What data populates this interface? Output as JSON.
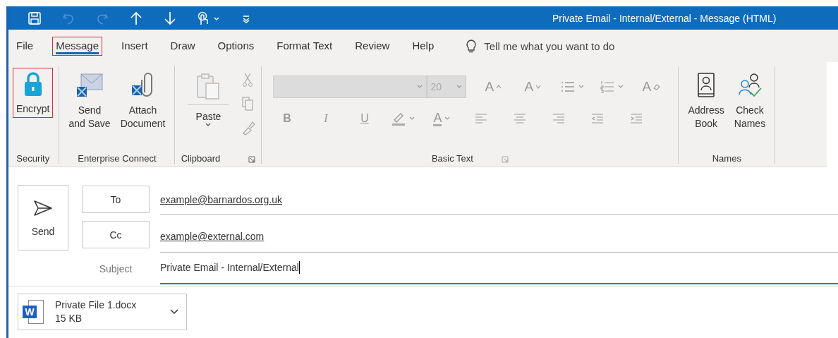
{
  "quick_access": [
    {
      "kind": "save",
      "disabled": false
    },
    {
      "kind": "undo",
      "disabled": true
    },
    {
      "kind": "redo",
      "disabled": true
    },
    {
      "kind": "up",
      "disabled": false
    },
    {
      "kind": "down",
      "disabled": false
    },
    {
      "kind": "touch",
      "disabled": false,
      "dropdown": true
    },
    {
      "kind": "customize",
      "disabled": false
    }
  ],
  "window": {
    "title": "Private Email - Internal/External  -  Message (HTML)"
  },
  "tabs": [
    {
      "label": "File",
      "selected": false,
      "highlighted": false
    },
    {
      "label": "Message",
      "selected": true,
      "highlighted": true
    },
    {
      "label": "Insert",
      "selected": false,
      "highlighted": false
    },
    {
      "label": "Draw",
      "selected": false,
      "highlighted": false
    },
    {
      "label": "Options",
      "selected": false,
      "highlighted": false
    },
    {
      "label": "Format Text",
      "selected": false,
      "highlighted": false
    },
    {
      "label": "Review",
      "selected": false,
      "highlighted": false
    },
    {
      "label": "Help",
      "selected": false,
      "highlighted": false
    }
  ],
  "tell_me": {
    "placeholder": "Tell me what you want to do"
  },
  "ribbon": {
    "security": {
      "label": "Security",
      "buttons": [
        {
          "lines": [
            "Encrypt"
          ],
          "highlighted": true
        }
      ]
    },
    "enterprise_connect": {
      "label": "Enterprise Connect",
      "buttons": [
        {
          "lines": [
            "Send",
            "and Save"
          ],
          "highlighted": false
        },
        {
          "lines": [
            "Attach",
            "Document"
          ],
          "highlighted": false
        }
      ]
    },
    "clipboard": {
      "label": "Clipboard",
      "launcher": true,
      "paste": {
        "label": "Paste"
      }
    },
    "basic_text": {
      "label": "Basic Text",
      "launcher": true,
      "font_size": {
        "value": "20"
      },
      "row_1": [
        {
          "kind": "grow",
          "label": "A"
        },
        {
          "kind": "shrink",
          "label": "A"
        },
        {
          "kind": "bullets",
          "dropdown": true
        },
        {
          "kind": "numbering",
          "dropdown": true
        },
        {
          "kind": "clear",
          "label": "A"
        }
      ],
      "row_2": [
        {
          "kind": "bold",
          "label": "B"
        },
        {
          "kind": "italic",
          "label": "I"
        },
        {
          "kind": "underline",
          "label": "U"
        },
        {
          "kind": "highlight",
          "dropdown": true
        },
        {
          "kind": "font-color",
          "label": "A",
          "dropdown": true
        },
        {
          "kind": "align-left"
        },
        {
          "kind": "align-center"
        },
        {
          "kind": "align-right"
        },
        {
          "kind": "outdent"
        },
        {
          "kind": "indent"
        }
      ]
    },
    "names": {
      "label": "Names",
      "buttons": [
        {
          "lines": [
            "Address",
            "Book"
          ],
          "highlighted": false
        },
        {
          "lines": [
            "Check",
            "Names"
          ],
          "highlighted": false
        }
      ]
    }
  },
  "compose": {
    "send": {
      "label": "Send"
    },
    "recipients": [
      {
        "button": "To",
        "value": "example@barnardos.org.uk"
      },
      {
        "button": "Cc",
        "value": "example@external.com"
      }
    ],
    "subject": {
      "label": "Subject",
      "value": "Private Email - Internal/External"
    },
    "attachments": [
      {
        "name": "Private File 1.docx",
        "size": "15 KB",
        "icon_letter": "W"
      }
    ]
  }
}
